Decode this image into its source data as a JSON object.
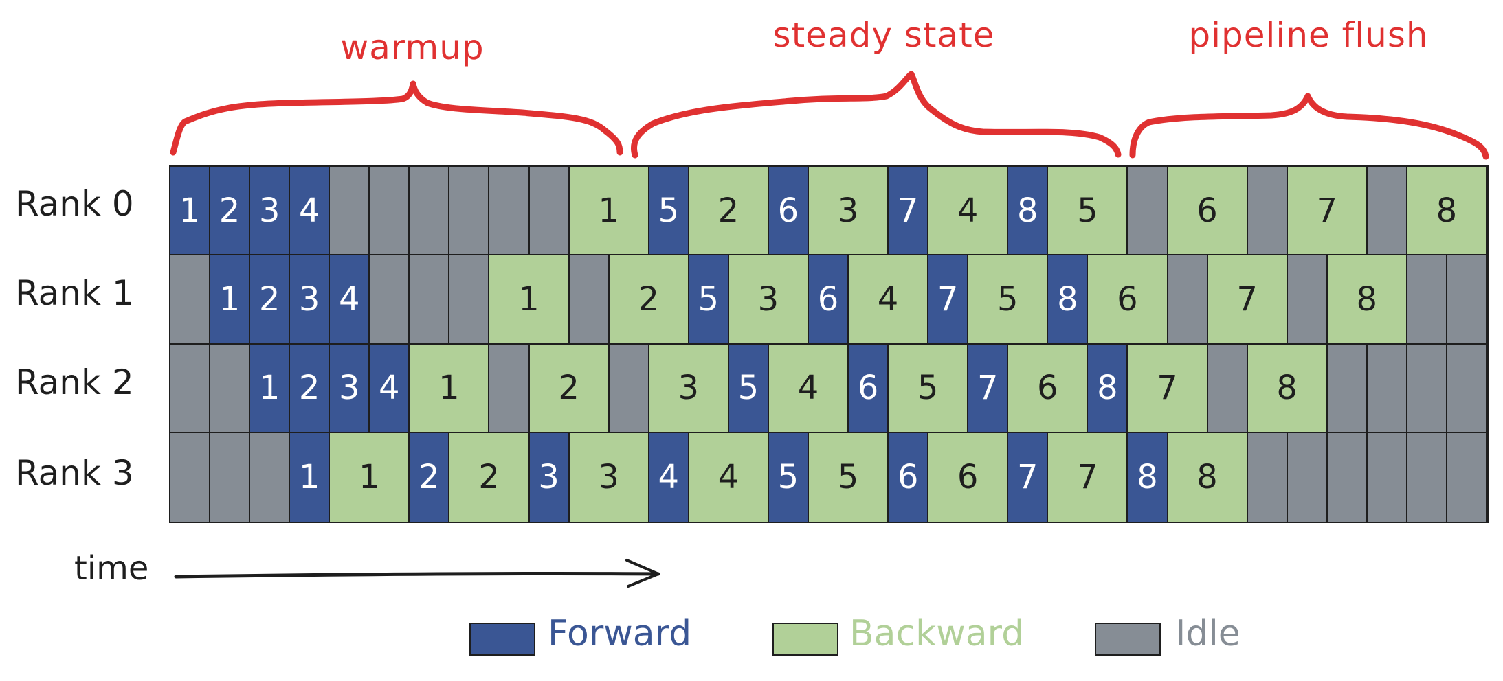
{
  "phases": [
    {
      "label": "warmup"
    },
    {
      "label": "steady state"
    },
    {
      "label": "pipeline flush"
    }
  ],
  "time_axis": {
    "label": "time",
    "direction": "right-arrow"
  },
  "legend": [
    {
      "key": "F",
      "label": "Forward",
      "color": "#3a5694"
    },
    {
      "key": "B",
      "label": "Backward",
      "color": "#b1d098"
    },
    {
      "key": "I",
      "label": "Idle",
      "color": "#868d95"
    }
  ],
  "colors": {
    "forward": "#3a5694",
    "backward": "#b1d098",
    "idle": "#868d95",
    "annotation": "#e03131",
    "ink": "#1e1e1e"
  },
  "chart_data": {
    "type": "gantt",
    "title": "",
    "xlabel": "time",
    "time_units_total": 33,
    "unit_durations": {
      "F": 1,
      "B": 2,
      "I": 1
    },
    "rows": [
      {
        "label": "Rank 0",
        "tasks": [
          [
            "F",
            "1"
          ],
          [
            "F",
            "2"
          ],
          [
            "F",
            "3"
          ],
          [
            "F",
            "4"
          ],
          [
            "I",
            ""
          ],
          [
            "I",
            ""
          ],
          [
            "I",
            ""
          ],
          [
            "I",
            ""
          ],
          [
            "I",
            ""
          ],
          [
            "I",
            ""
          ],
          [
            "B",
            "1"
          ],
          [
            "F",
            "5"
          ],
          [
            "B",
            "2"
          ],
          [
            "F",
            "6"
          ],
          [
            "B",
            "3"
          ],
          [
            "F",
            "7"
          ],
          [
            "B",
            "4"
          ],
          [
            "F",
            "8"
          ],
          [
            "B",
            "5"
          ],
          [
            "I",
            ""
          ],
          [
            "B",
            "6"
          ],
          [
            "I",
            ""
          ],
          [
            "B",
            "7"
          ],
          [
            "I",
            ""
          ],
          [
            "B",
            "8"
          ]
        ]
      },
      {
        "label": "Rank 1",
        "tasks": [
          [
            "I",
            ""
          ],
          [
            "F",
            "1"
          ],
          [
            "F",
            "2"
          ],
          [
            "F",
            "3"
          ],
          [
            "F",
            "4"
          ],
          [
            "I",
            ""
          ],
          [
            "I",
            ""
          ],
          [
            "I",
            ""
          ],
          [
            "B",
            "1"
          ],
          [
            "I",
            ""
          ],
          [
            "B",
            "2"
          ],
          [
            "F",
            "5"
          ],
          [
            "B",
            "3"
          ],
          [
            "F",
            "6"
          ],
          [
            "B",
            "4"
          ],
          [
            "F",
            "7"
          ],
          [
            "B",
            "5"
          ],
          [
            "F",
            "8"
          ],
          [
            "B",
            "6"
          ],
          [
            "I",
            ""
          ],
          [
            "B",
            "7"
          ],
          [
            "I",
            ""
          ],
          [
            "B",
            "8"
          ],
          [
            "I",
            ""
          ],
          [
            "I",
            ""
          ]
        ]
      },
      {
        "label": "Rank 2",
        "tasks": [
          [
            "I",
            ""
          ],
          [
            "I",
            ""
          ],
          [
            "F",
            "1"
          ],
          [
            "F",
            "2"
          ],
          [
            "F",
            "3"
          ],
          [
            "F",
            "4"
          ],
          [
            "B",
            "1"
          ],
          [
            "I",
            ""
          ],
          [
            "B",
            "2"
          ],
          [
            "I",
            ""
          ],
          [
            "B",
            "3"
          ],
          [
            "F",
            "5"
          ],
          [
            "B",
            "4"
          ],
          [
            "F",
            "6"
          ],
          [
            "B",
            "5"
          ],
          [
            "F",
            "7"
          ],
          [
            "B",
            "6"
          ],
          [
            "F",
            "8"
          ],
          [
            "B",
            "7"
          ],
          [
            "I",
            ""
          ],
          [
            "B",
            "8"
          ],
          [
            "I",
            ""
          ],
          [
            "I",
            ""
          ],
          [
            "I",
            ""
          ],
          [
            "I",
            ""
          ]
        ]
      },
      {
        "label": "Rank 3",
        "tasks": [
          [
            "I",
            ""
          ],
          [
            "I",
            ""
          ],
          [
            "I",
            ""
          ],
          [
            "F",
            "1"
          ],
          [
            "B",
            "1"
          ],
          [
            "F",
            "2"
          ],
          [
            "B",
            "2"
          ],
          [
            "F",
            "3"
          ],
          [
            "B",
            "3"
          ],
          [
            "F",
            "4"
          ],
          [
            "B",
            "4"
          ],
          [
            "F",
            "5"
          ],
          [
            "B",
            "5"
          ],
          [
            "F",
            "6"
          ],
          [
            "B",
            "6"
          ],
          [
            "F",
            "7"
          ],
          [
            "B",
            "7"
          ],
          [
            "F",
            "8"
          ],
          [
            "B",
            "8"
          ],
          [
            "I",
            ""
          ],
          [
            "I",
            ""
          ],
          [
            "I",
            ""
          ],
          [
            "I",
            ""
          ],
          [
            "I",
            ""
          ],
          [
            "I",
            ""
          ]
        ]
      }
    ],
    "phase_spans_units": [
      {
        "label": "warmup",
        "start": 0,
        "end": 11
      },
      {
        "label": "steady state",
        "start": 11,
        "end": 24
      },
      {
        "label": "pipeline flush",
        "start": 24,
        "end": 33
      }
    ]
  }
}
